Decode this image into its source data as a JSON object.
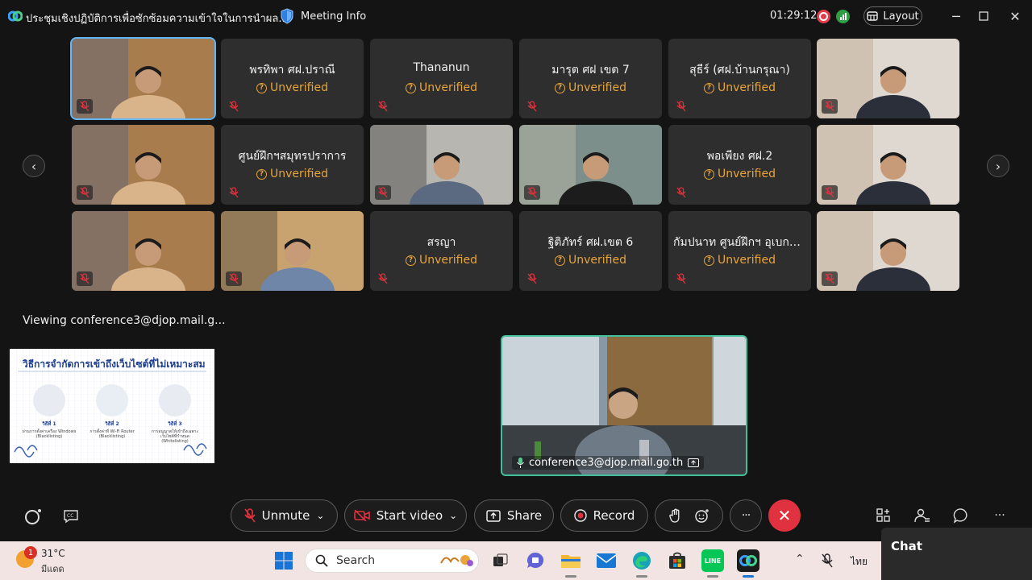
{
  "titlebar": {
    "title": "ประชุมเชิงปฏิบัติการเพื่อซักซ้อมความเข้าใจในการนำผล...",
    "meeting_info": "Meeting Info",
    "timer": "01:29:12",
    "layout_label": "Layout"
  },
  "grid": {
    "tiles": [
      {
        "name": "",
        "status": "",
        "video": true
      },
      {
        "name": "พรทิพา ศฝ.ปราณี",
        "status": "Unverified",
        "video": false
      },
      {
        "name": "Thananun",
        "status": "Unverified",
        "video": false
      },
      {
        "name": "มารุต ศฝ เขต 7",
        "status": "Unverified",
        "video": false
      },
      {
        "name": "สุธีร์ (ศฝ.บ้านกรุณา)",
        "status": "Unverified",
        "video": false
      },
      {
        "name": "",
        "status": "",
        "video": true
      },
      {
        "name": "",
        "status": "",
        "video": true
      },
      {
        "name": "ศูนย์ฝึกฯสมุทรปราการ",
        "status": "Unverified",
        "video": false
      },
      {
        "name": "",
        "status": "",
        "video": true
      },
      {
        "name": "",
        "status": "",
        "video": true
      },
      {
        "name": "พอเพียง ศฝ.2",
        "status": "Unverified",
        "video": false
      },
      {
        "name": "",
        "status": "",
        "video": true
      },
      {
        "name": "",
        "status": "",
        "video": true
      },
      {
        "name": "",
        "status": "",
        "video": true
      },
      {
        "name": "สรญา",
        "status": "Unverified",
        "video": false
      },
      {
        "name": "ฐิติภัทร์ ศฝ.เขต 6",
        "status": "Unverified",
        "video": false
      },
      {
        "name": "กัมปนาท ศูนย์ฝึกฯ อุเบกข...",
        "status": "Unverified",
        "video": false
      },
      {
        "name": "",
        "status": "",
        "video": true
      }
    ]
  },
  "viewing": "Viewing conference3@djop.mail.g...",
  "share": {
    "title": "วิธีการจำกัดการเข้าถึงเว็บไซต์ที่ไม่เหมาะสม",
    "cols": [
      {
        "label": "วิธีที่ 1",
        "sub": "ผ่านการตั้งค่าเครื่อง Windows (Blacklisting)"
      },
      {
        "label": "วิธีที่ 2",
        "sub": "การตั้งค่าที่ Wi-Fi Router (Blacklisting)"
      },
      {
        "label": "วิธีที่ 3",
        "sub": "การอนุญาตให้เข้าถึงเฉพาะเว็บไซต์ที่กำหนด (Whitelisting)"
      }
    ]
  },
  "main_video": {
    "name": "conference3@djop.mail.go.th"
  },
  "controls": {
    "unmute": "Unmute",
    "start_video": "Start video",
    "share": "Share",
    "record": "Record",
    "more": "···"
  },
  "taskbar": {
    "weather_badge": "1",
    "temp": "31°C",
    "condition": "มีแดด",
    "search": "Search",
    "lang": "ไทย",
    "line_label": "LINE"
  },
  "chat": {
    "title": "Chat"
  },
  "colors": {
    "accent_unverified": "#e8a43a",
    "leave": "#e0323e",
    "active_border": "#3fbf9a"
  }
}
